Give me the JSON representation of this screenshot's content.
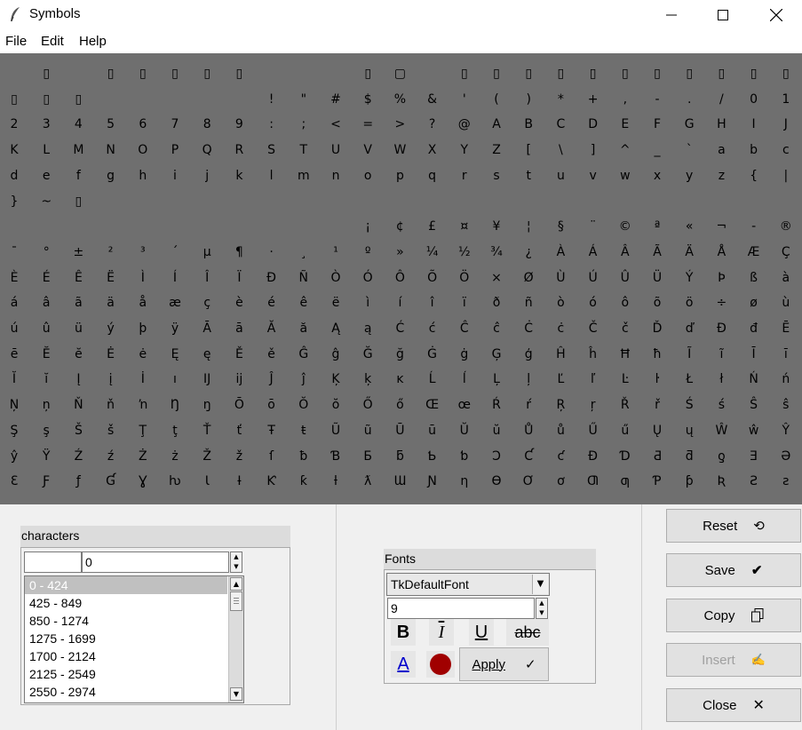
{
  "window": {
    "title": "Symbols"
  },
  "menu": [
    "File",
    "Edit",
    "Help"
  ],
  "grid": {
    "rows": [
      [
        "",
        "▯",
        "",
        "▯",
        "▯",
        "▯",
        "▯",
        "▯",
        "",
        "",
        "",
        "▯",
        "▢",
        "",
        "▯",
        "▯",
        "▯",
        "▯",
        "▯",
        "▯",
        "▯",
        "▯",
        "▯",
        "▯",
        "▯"
      ],
      [
        "▯",
        "▯",
        "▯",
        "",
        "",
        "",
        "",
        "",
        "!",
        "\"",
        "#",
        "$",
        "%",
        "&",
        "'",
        "(",
        ")",
        "*",
        "+",
        ",",
        "-",
        ".",
        "/",
        "0",
        "1"
      ],
      [
        "2",
        "3",
        "4",
        "5",
        "6",
        "7",
        "8",
        "9",
        ":",
        ";",
        "<",
        "=",
        ">",
        "?",
        "@",
        "A",
        "B",
        "C",
        "D",
        "E",
        "F",
        "G",
        "H",
        "I",
        "J"
      ],
      [
        "K",
        "L",
        "M",
        "N",
        "O",
        "P",
        "Q",
        "R",
        "S",
        "T",
        "U",
        "V",
        "W",
        "X",
        "Y",
        "Z",
        "[",
        "\\",
        "]",
        "^",
        "_",
        "`",
        "a",
        "b",
        "c"
      ],
      [
        "d",
        "e",
        "f",
        "g",
        "h",
        "i",
        "j",
        "k",
        "l",
        "m",
        "n",
        "o",
        "p",
        "q",
        "r",
        "s",
        "t",
        "u",
        "v",
        "w",
        "x",
        "y",
        "z",
        "{",
        "|"
      ],
      [
        "}",
        "~",
        "▯",
        "",
        "",
        "",
        "",
        "",
        "",
        "",
        "",
        "",
        "",
        "",
        "",
        "",
        "",
        "",
        "",
        "",
        "",
        "",
        "",
        "",
        ""
      ],
      [
        "",
        "",
        "",
        "",
        "",
        "",
        "",
        "",
        "",
        "",
        "",
        "¡",
        "¢",
        "£",
        "¤",
        "¥",
        "¦",
        "§",
        "¨",
        "©",
        "ª",
        "«",
        "¬",
        "-",
        "®"
      ],
      [
        "¯",
        "°",
        "±",
        "²",
        "³",
        "´",
        "µ",
        "¶",
        "·",
        "¸",
        "¹",
        "º",
        "»",
        "¼",
        "½",
        "¾",
        "¿",
        "À",
        "Á",
        "Â",
        "Ã",
        "Ä",
        "Å",
        "Æ",
        "Ç"
      ],
      [
        "È",
        "É",
        "Ê",
        "Ë",
        "Ì",
        "Í",
        "Î",
        "Ï",
        "Ð",
        "Ñ",
        "Ò",
        "Ó",
        "Ô",
        "Õ",
        "Ö",
        "×",
        "Ø",
        "Ù",
        "Ú",
        "Û",
        "Ü",
        "Ý",
        "Þ",
        "ß",
        "à"
      ],
      [
        "á",
        "â",
        "ã",
        "ä",
        "å",
        "æ",
        "ç",
        "è",
        "é",
        "ê",
        "ë",
        "ì",
        "í",
        "î",
        "ï",
        "ð",
        "ñ",
        "ò",
        "ó",
        "ô",
        "õ",
        "ö",
        "÷",
        "ø",
        "ù"
      ],
      [
        "ú",
        "û",
        "ü",
        "ý",
        "þ",
        "ÿ",
        "Ā",
        "ā",
        "Ă",
        "ă",
        "Ą",
        "ą",
        "Ć",
        "ć",
        "Ĉ",
        "ĉ",
        "Ċ",
        "ċ",
        "Č",
        "č",
        "Ď",
        "ď",
        "Đ",
        "đ",
        "Ē"
      ],
      [
        "ē",
        "Ĕ",
        "ĕ",
        "Ė",
        "ė",
        "Ę",
        "ę",
        "Ě",
        "ě",
        "Ĝ",
        "ĝ",
        "Ğ",
        "ğ",
        "Ġ",
        "ġ",
        "Ģ",
        "ģ",
        "Ĥ",
        "ĥ",
        "Ħ",
        "ħ",
        "Ĩ",
        "ĩ",
        "Ī",
        "ī"
      ],
      [
        "Ĭ",
        "ĭ",
        "Į",
        "į",
        "İ",
        "ı",
        "Ĳ",
        "ĳ",
        "Ĵ",
        "ĵ",
        "Ķ",
        "ķ",
        "ĸ",
        "Ĺ",
        "ĺ",
        "Ļ",
        "ļ",
        "Ľ",
        "ľ",
        "Ŀ",
        "ŀ",
        "Ł",
        "ł",
        "Ń",
        "ń"
      ],
      [
        "Ņ",
        "ņ",
        "Ň",
        "ň",
        "ŉ",
        "Ŋ",
        "ŋ",
        "Ō",
        "ō",
        "Ŏ",
        "ŏ",
        "Ő",
        "ő",
        "Œ",
        "œ",
        "Ŕ",
        "ŕ",
        "Ŗ",
        "ŗ",
        "Ř",
        "ř",
        "Ś",
        "ś",
        "Ŝ",
        "ŝ"
      ],
      [
        "Ş",
        "ş",
        "Š",
        "š",
        "Ţ",
        "ţ",
        "Ť",
        "ť",
        "Ŧ",
        "ŧ",
        "Ũ",
        "ũ",
        "Ū",
        "ū",
        "Ŭ",
        "ŭ",
        "Ů",
        "ů",
        "Ű",
        "ű",
        "Ų",
        "ų",
        "Ŵ",
        "ŵ",
        "Ŷ"
      ],
      [
        "ŷ",
        "Ÿ",
        "Ź",
        "ź",
        "Ż",
        "ż",
        "Ž",
        "ž",
        "ſ",
        "ƀ",
        "Ɓ",
        "Ƃ",
        "ƃ",
        "Ƅ",
        "ƅ",
        "Ɔ",
        "Ƈ",
        "ƈ",
        "Ɖ",
        "Ɗ",
        "Ƌ",
        "ƌ",
        "ƍ",
        "Ǝ",
        "Ə"
      ],
      [
        "Ɛ",
        "Ƒ",
        "ƒ",
        "Ɠ",
        "Ɣ",
        "ƕ",
        "Ɩ",
        "Ɨ",
        "Ƙ",
        "ƙ",
        "ƚ",
        "ƛ",
        "Ɯ",
        "Ɲ",
        "ƞ",
        "Ɵ",
        "Ơ",
        "ơ",
        "Ƣ",
        "ƣ",
        "Ƥ",
        "ƥ",
        "Ʀ",
        "Ƨ",
        "ƨ"
      ]
    ]
  },
  "characters": {
    "title": "characters",
    "filter_value": "",
    "spin_value": "0",
    "ranges": [
      "0 - 424",
      "425 - 849",
      "850 - 1274",
      "1275 - 1699",
      "1700 - 2124",
      "2125 - 2549",
      "2550 - 2974"
    ],
    "selected_index": 0
  },
  "fonts": {
    "title": "Fonts",
    "family": "TkDefaultFont",
    "size": "9",
    "bold_label": "B",
    "italic_label": "I",
    "underline_label": "U",
    "strike_label": "abc",
    "color_label": "A",
    "apply_label": "Apply",
    "text_color": "#0000cc",
    "swatch_color": "#a00000"
  },
  "buttons": {
    "reset": "Reset",
    "save": "Save",
    "copy": "Copy",
    "insert": "Insert",
    "close": "Close"
  }
}
